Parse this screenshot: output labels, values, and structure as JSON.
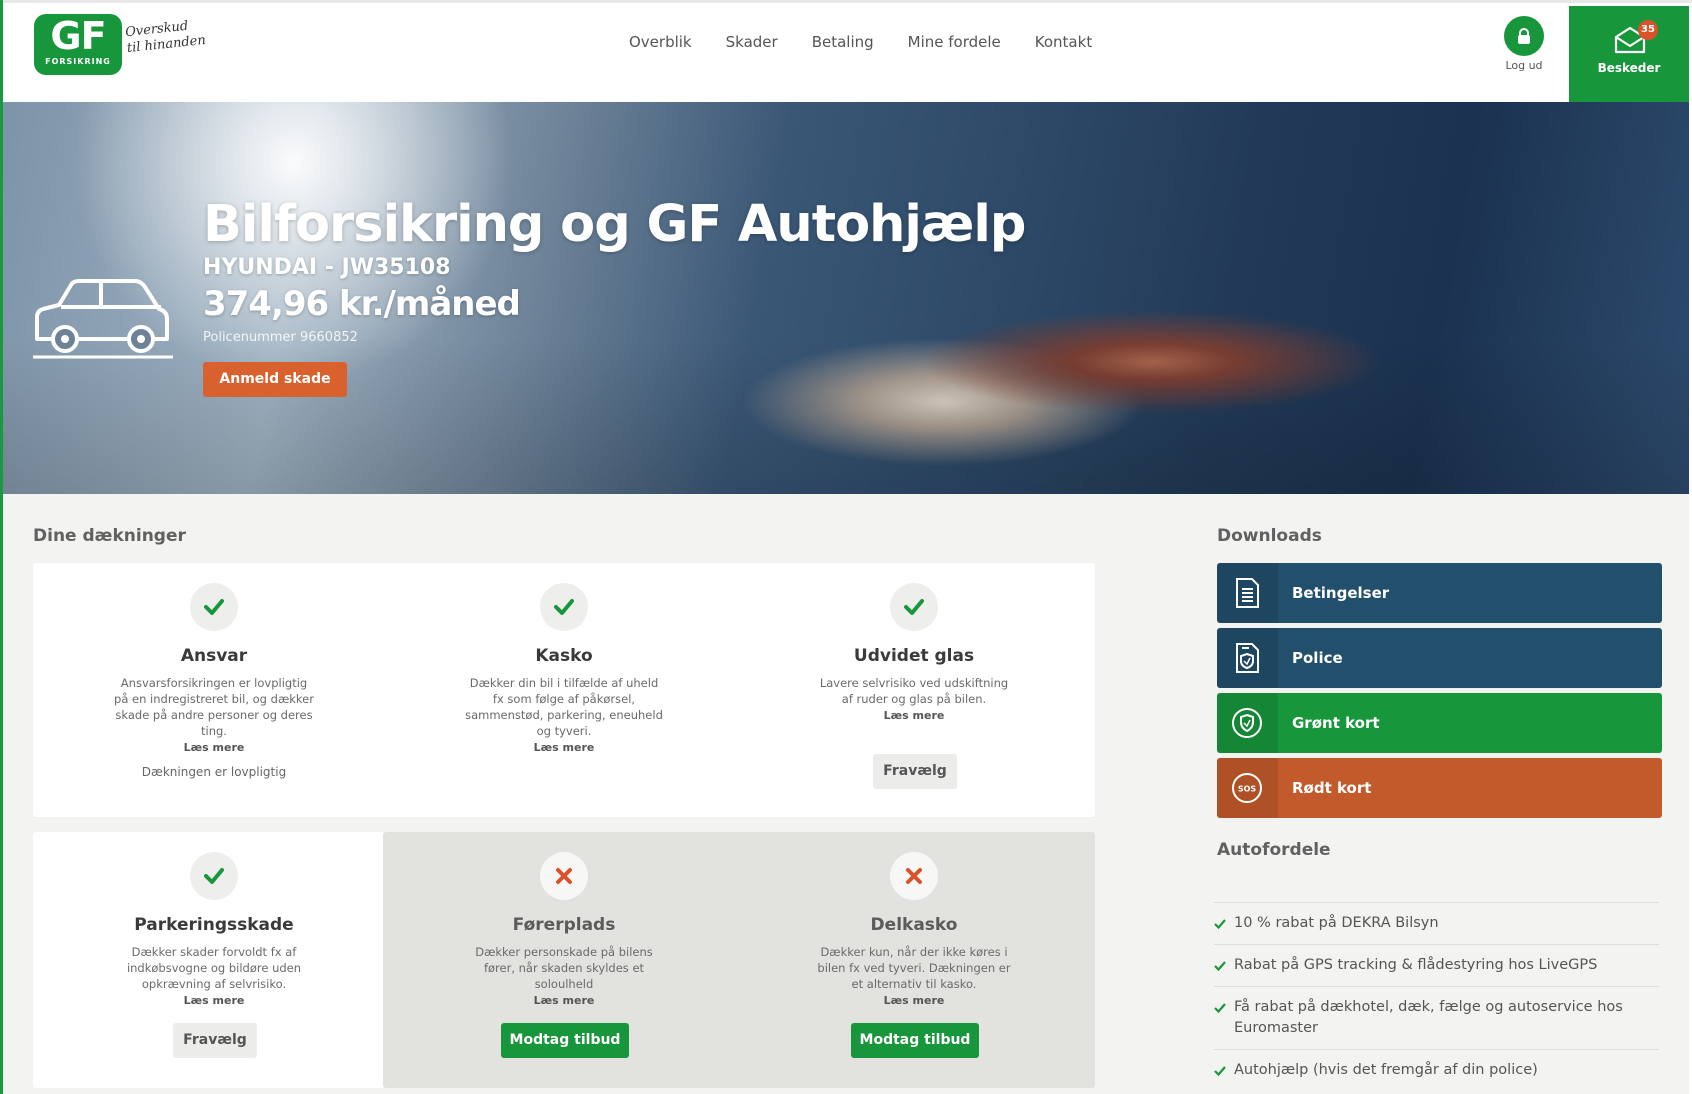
{
  "header": {
    "logo_text": "GF",
    "logo_subtext": "FORSIKRING",
    "slogan": "Overskud til hinanden",
    "nav": [
      "Overblik",
      "Skader",
      "Betaling",
      "Mine fordele",
      "Kontakt"
    ],
    "logout_label": "Log ud",
    "messages_label": "Besked er",
    "messages_label_clean": "Beskeder",
    "messages_count": "35"
  },
  "hero": {
    "title": "Bilforsikring og GF Autohjælp",
    "vehicle": "HYUNDAI - JW35108",
    "price": "374,96 kr./måned",
    "policy": "Policenummer 9660852",
    "cta": "Anmeld skade"
  },
  "coverages": {
    "heading": "Dine dækninger",
    "read_more": "Læs mere",
    "cards": [
      {
        "title": "Ansvar",
        "desc": "Ansvarsforsikringen er lovpligtig på en indregistreret bil, og dækker skade på andre personer og deres ting.",
        "status": "included",
        "note": "Dækningen er lovpligtig"
      },
      {
        "title": "Kasko",
        "desc": "Dækker din bil i tilfælde af uheld fx som følge af påkørsel, sammenstød, parkering, eneuheld og tyveri.",
        "status": "included"
      },
      {
        "title": "Udvidet glas",
        "desc": "Lavere selvrisiko ved udskiftning af ruder og glas på bilen.",
        "status": "included",
        "button": "Fravælg"
      },
      {
        "title": "Parkeringsskade",
        "desc": "Dækker skader forvoldt fx af indkøbsvogne og bildøre uden opkrævning af selvrisiko.",
        "status": "included",
        "button": "Fravælg"
      },
      {
        "title": "Førerplads",
        "desc": "Dækker personskade på bilens fører, når skaden skyldes et soloulheld",
        "status": "excluded",
        "button": "Modtag tilbud"
      },
      {
        "title": "Delkasko",
        "desc": "Dækker kun, når der ikke køres i bilen fx ved tyveri. Dækningen er et alternativ til kasko.",
        "status": "excluded",
        "button": "Modtag tilbud"
      }
    ]
  },
  "downloads": {
    "heading": "Downloads",
    "items": [
      {
        "label": "Betingelser",
        "icon": "document-icon",
        "color": "#224f6c"
      },
      {
        "label": "Police",
        "icon": "shield-document-icon",
        "color": "#224f6c"
      },
      {
        "label": "Grønt kort",
        "icon": "shield-icon",
        "color": "#18963c"
      },
      {
        "label": "Rødt kort",
        "icon": "sos-icon",
        "color": "#c35a2c",
        "icon_text": "SOS"
      }
    ]
  },
  "autofordele": {
    "heading": "Autofordele",
    "items": [
      "10 % rabat på DEKRA Bilsyn",
      "Rabat på GPS tracking & flådestyring hos LiveGPS",
      "Få rabat på dækhotel, dæk, fælge og autoservice hos Euromaster",
      "Autohjælp (hvis det fremgår af din police)"
    ]
  },
  "colors": {
    "brand_green": "#18963c",
    "orange": "#d9612d",
    "navy": "#224f6c"
  }
}
